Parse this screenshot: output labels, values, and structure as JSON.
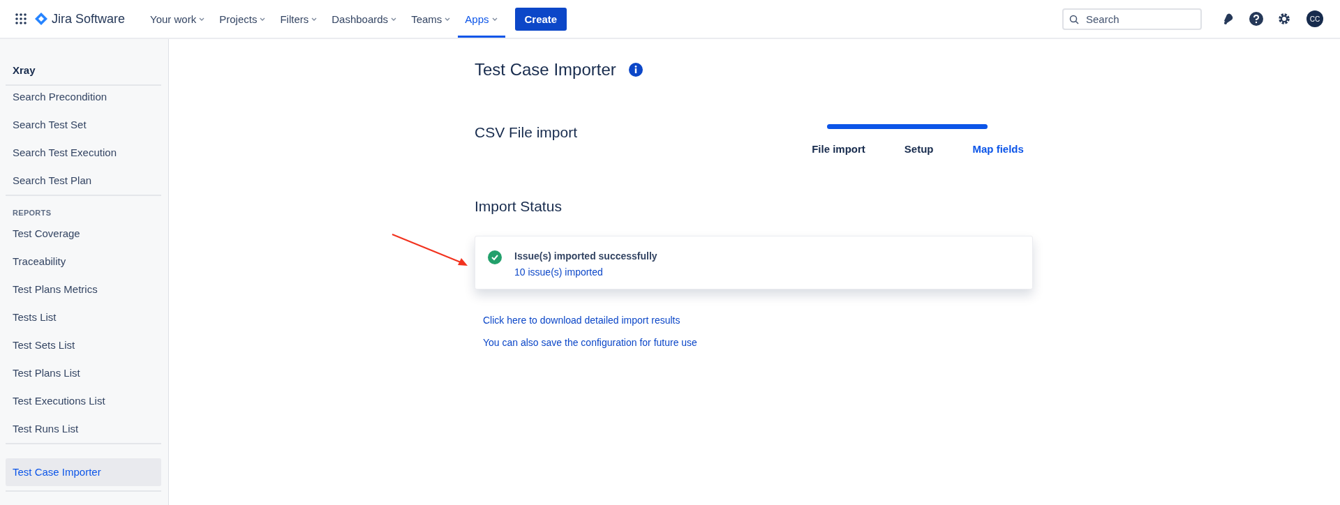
{
  "topbar": {
    "product": "Jira Software",
    "nav": [
      {
        "label": "Your work",
        "selected": false
      },
      {
        "label": "Projects",
        "selected": false
      },
      {
        "label": "Filters",
        "selected": false
      },
      {
        "label": "Dashboards",
        "selected": false
      },
      {
        "label": "Teams",
        "selected": false
      },
      {
        "label": "Apps",
        "selected": true
      }
    ],
    "create": "Create",
    "search": {
      "placeholder": "Search"
    },
    "avatar": "CC"
  },
  "sidebar": {
    "title": "Xray",
    "groups": [
      {
        "items": [
          {
            "label": "Search Precondition",
            "selected": false
          },
          {
            "label": "Search Test Set",
            "selected": false
          },
          {
            "label": "Search Test Execution",
            "selected": false
          },
          {
            "label": "Search Test Plan",
            "selected": false
          }
        ]
      },
      {
        "heading": "REPORTS",
        "items": [
          {
            "label": "Test Coverage",
            "selected": false
          },
          {
            "label": "Traceability",
            "selected": false
          },
          {
            "label": "Test Plans Metrics",
            "selected": false
          },
          {
            "label": "Tests List",
            "selected": false
          },
          {
            "label": "Test Sets List",
            "selected": false
          },
          {
            "label": "Test Plans List",
            "selected": false
          },
          {
            "label": "Test Executions List",
            "selected": false
          },
          {
            "label": "Test Runs List",
            "selected": false
          }
        ]
      },
      {
        "items": [
          {
            "label": "Test Case Importer",
            "selected": true
          }
        ]
      }
    ]
  },
  "main": {
    "title": "Test Case Importer",
    "section": "CSV File import",
    "progress": {
      "level": 1
    },
    "steps": [
      {
        "label": "File import",
        "selected": false
      },
      {
        "label": "Setup",
        "selected": false
      },
      {
        "label": "Map fields",
        "selected": true
      }
    ],
    "status_heading": "Import Status",
    "status": {
      "message": "Issue(s) imported successfully",
      "detail": "10 issue(s) imported"
    },
    "links": [
      "Click here to download detailed import results",
      "You can also save the configuration for future use"
    ]
  }
}
